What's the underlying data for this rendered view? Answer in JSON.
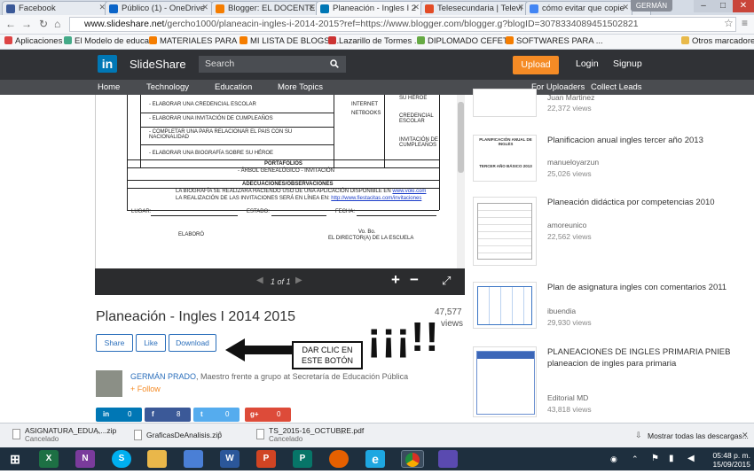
{
  "tabs": [
    {
      "label": "Facebook",
      "color": "#3b5998"
    },
    {
      "label": "Público (1) - OneDrive",
      "color": "#0a64c8"
    },
    {
      "label": "Blogger: EL DOCENTE",
      "color": "#f57d00"
    },
    {
      "label": "Planeación - Ingles I 2",
      "color": "#0077b5"
    },
    {
      "label": "Telesecundaria | Televi",
      "color": "#e34c26"
    },
    {
      "label": "cómo evitar que copie",
      "color": "#4285f4"
    }
  ],
  "window": {
    "user": "GERMÁN",
    "minimize": "–",
    "maximize": "□",
    "close": "✕"
  },
  "address": {
    "host": "www.slideshare.net",
    "path": "/gercho1000/planeacin-ingles-i-2014-2015?ref=https://www.blogger.com/blogger.g?blogID=3078334089451502821"
  },
  "bookmarks": [
    {
      "label": "Aplicaciones",
      "color": "#d44"
    },
    {
      "label": "El Modelo de educa...",
      "color": "#4a8"
    },
    {
      "label": "MATERIALES PARA ...",
      "color": "#f57d00"
    },
    {
      "label": "MI LISTA DE BLOGS ...",
      "color": "#f57d00"
    },
    {
      "label": "Lazarillo de Tormes ...",
      "color": "#c33"
    },
    {
      "label": "DIPLOMADO CEFET...",
      "color": "#6a4"
    },
    {
      "label": "SOFTWARES PARA ...",
      "color": "#f57d00"
    },
    {
      "label": "Otros marcadores",
      "color": "#e8b94a"
    }
  ],
  "header": {
    "logo": "in",
    "brand": "SlideShare",
    "search_placeholder": "Search",
    "upload": "Upload",
    "login": "Login",
    "signup": "Signup"
  },
  "nav": {
    "home": "Home",
    "technology": "Technology",
    "education": "Education",
    "more": "More Topics",
    "uploaders": "For Uploaders",
    "leads": "Collect Leads"
  },
  "doc": {
    "r1": "ELABORAR UNA CREDENCIAL ESCOLAR",
    "r2": "ELABORAR UNA INVITACIÓN DE CUMPLEAÑOS",
    "r3": "COMPLETAR UNA PARA RELACIONAR EL PAIS CON SU NACIONALIDAD",
    "r4": "ELABORAR UNA BIOGRAFÍA SOBRE SU HÉROE",
    "c1": "INTERNET",
    "c2": "NETBOOKS",
    "c3": "SU HÉROE",
    "c4": "CREDENCIAL ESCOLAR",
    "c5": "INVITACIÓN DE CUMPLEAÑOS",
    "portafolios": "PORTAFOLIOS",
    "arbol": "- ÁRBOL GENEALÓGICO - INVITACIÓN",
    "adecuaciones": "ADECUACIONES/OBSERVACIONES",
    "obs1": "LA BIOGRAFÍA SE REALIZARA HACIENDO USO DE UNA APLICACIÓN DISPONIBLE EN",
    "obs1_link": "www.voki.com",
    "obs2": "LA REALIZACIÓN DE LAS INVITACIONES SERÁ EN LÍNEA EN:",
    "obs2_link": "http://www.fiestacitas.com/invitaciones",
    "lugar": "LUGAR:",
    "estado": "ESTADO:",
    "fecha": "FECHA:",
    "elaboro": "ELABORÓ",
    "vobo": "Vo. Bo.",
    "director": "EL DIRECTOR(A) DE LA ESCUELA"
  },
  "viewer": {
    "page": "1 of 1"
  },
  "presentation": {
    "title": "Planeación - Ingles I 2014 2015",
    "views_count": "47,577",
    "views_label": "views"
  },
  "actions": {
    "share": "Share",
    "like": "Like",
    "download": "Download"
  },
  "annotation": {
    "line1": "DAR CLIC EN",
    "line2": "ESTE BOTÓN",
    "exclaim": "¡¡¡!!"
  },
  "author": {
    "name": "GERMÁN PRADO",
    "bio": ", Maestro frente a grupo at Secretaría de Educación Pública",
    "follow": "+ Follow"
  },
  "social": [
    {
      "name": "in",
      "count": "0",
      "color": "#0077b5"
    },
    {
      "name": "f",
      "count": "8",
      "color": "#3b5998"
    },
    {
      "name": "t",
      "count": "0",
      "color": "#55acee"
    },
    {
      "name": "g+",
      "count": "0",
      "color": "#dd4b39"
    }
  ],
  "sidebar": [
    {
      "title": "",
      "author": "Juan Martinez",
      "views": "22,372 views"
    },
    {
      "title": "Planificacion anual ingles tercer año 2013",
      "author": "manueloyarzun",
      "views": "25,026 views",
      "thumb_l1": "PLANIFICACIÓN ANUAL DE INGLÉS",
      "thumb_l2": "TERCER AÑO BÁSICO 2013"
    },
    {
      "title": "Planeación didáctica por competencias 2010",
      "author": "amoreunico",
      "views": "22,562 views"
    },
    {
      "title": "Plan de asignatura ingles con comentarios 2011",
      "author": "ibuendia",
      "views": "29,930 views"
    },
    {
      "title": "PLANEACIONES DE INGLES PRIMARIA PNIEB planeacion de ingles para primaria",
      "author": "Editorial MD",
      "views": "43,818 views"
    }
  ],
  "downloads": [
    {
      "name": "ASIGNATURA_EDUA....zip",
      "status": "Cancelado"
    },
    {
      "name": "GraficasDeAnalisis.zip",
      "status": ""
    },
    {
      "name": "TS_2015-16_OCTUBRE.pdf",
      "status": "Cancelado"
    }
  ],
  "downloads_all": "Mostrar todas las descargas...",
  "taskbar": [
    {
      "name": "excel",
      "label": "X",
      "color": "#1d7044"
    },
    {
      "name": "onenote",
      "label": "N",
      "color": "#7a3b9c"
    },
    {
      "name": "skype",
      "label": "S",
      "color": "#00aff0"
    },
    {
      "name": "explorer",
      "label": "",
      "color": "#e9b74a"
    },
    {
      "name": "store",
      "label": "",
      "color": "#4a7fd6"
    },
    {
      "name": "word",
      "label": "W",
      "color": "#2b579a"
    },
    {
      "name": "powerpoint",
      "label": "P",
      "color": "#d04423"
    },
    {
      "name": "publisher",
      "label": "P",
      "color": "#077568"
    },
    {
      "name": "firefox",
      "label": "",
      "color": "#e66000"
    },
    {
      "name": "ie",
      "label": "e",
      "color": "#1ea7e1"
    },
    {
      "name": "chrome",
      "label": "",
      "color": "#d93025"
    },
    {
      "name": "app",
      "label": "",
      "color": "#5a4ab0"
    }
  ],
  "clock": {
    "time": "05:48 p. m.",
    "date": "15/09/2015"
  }
}
